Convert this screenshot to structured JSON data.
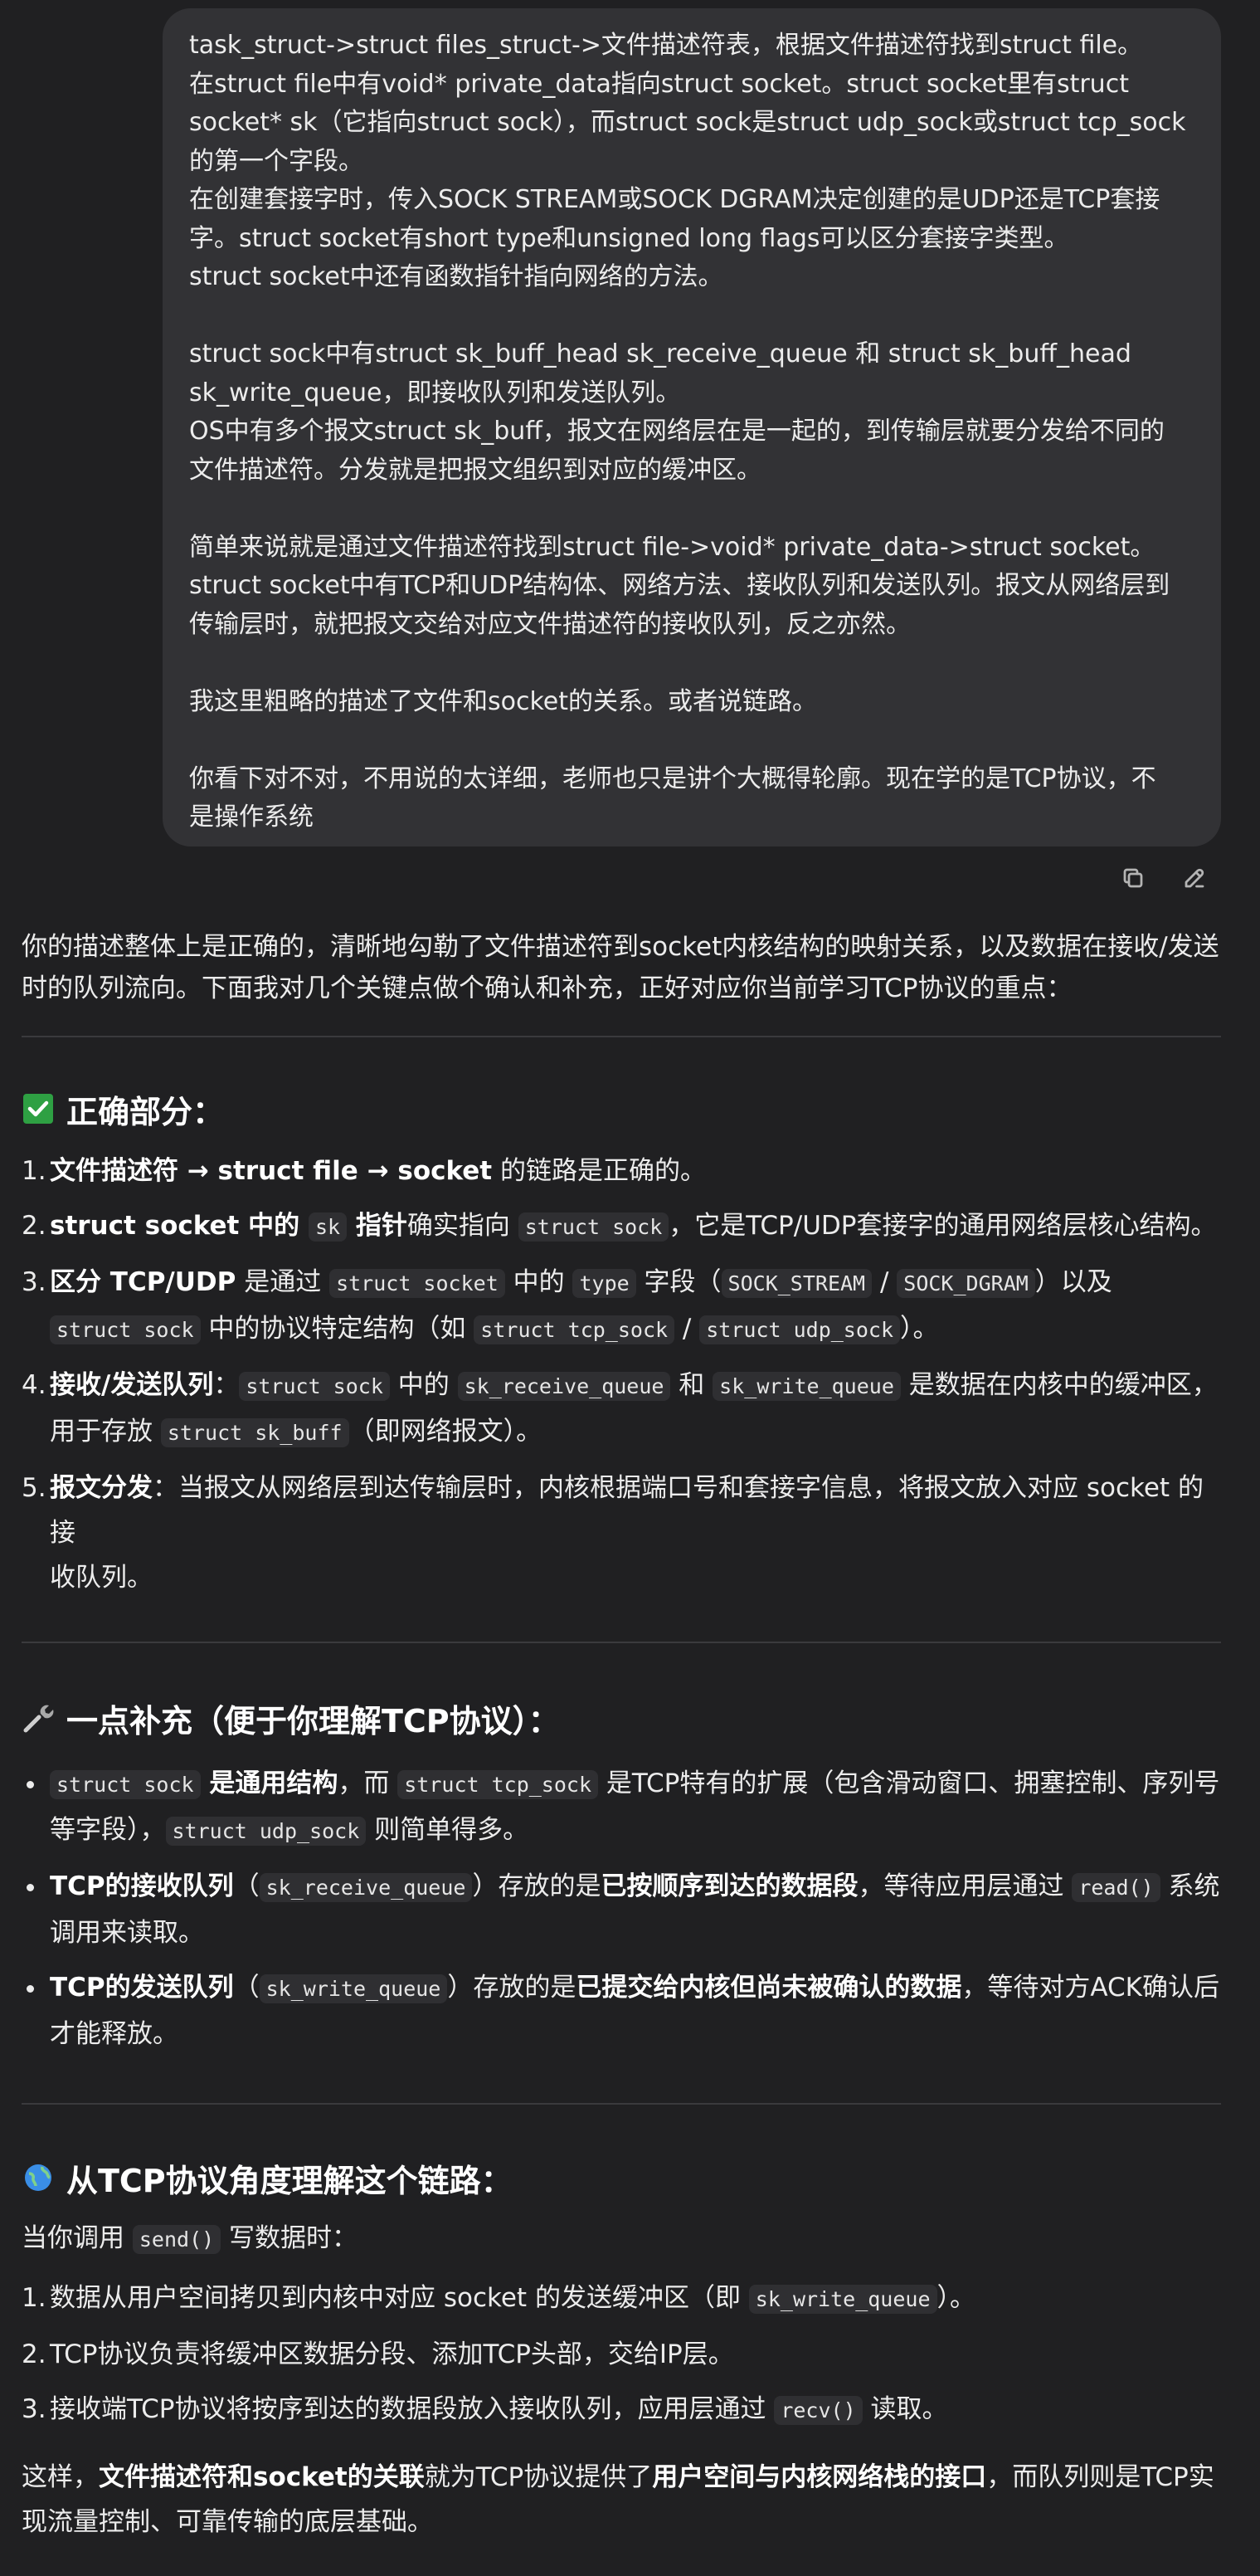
{
  "user_message": {
    "lines": [
      "task_struct->struct files_struct->文件描述符表，根据文件描述符找到struct file。",
      "在struct file中有void* private_data指向struct socket。struct socket里有struct",
      "socket* sk（它指向struct sock），而struct sock是struct udp_sock或struct tcp_sock",
      "的第一个字段。",
      "在创建套接字时，传入SOCK STREAM或SOCK DGRAM决定创建的是UDP还是TCP套接",
      "字。struct socket有short type和unsigned long flags可以区分套接字类型。",
      "struct socket中还有函数指针指向网络的方法。",
      "",
      "struct sock中有struct sk_buff_head sk_receive_queue 和 struct sk_buff_head",
      "sk_write_queue，即接收队列和发送队列。",
      "OS中有多个报文struct sk_buff，报文在网络层在是一起的，到传输层就要分发给不同的",
      "文件描述符。分发就是把报文组织到对应的缓冲区。",
      "",
      "简单来说就是通过文件描述符找到struct file->void* private_data->struct socket。",
      "struct socket中有TCP和UDP结构体、网络方法、接收队列和发送队列。报文从网络层到",
      "传输层时，就把报文交给对应文件描述符的接收队列，反之亦然。",
      "",
      "我这里粗略的描述了文件和socket的关系。或者说链路。",
      "",
      "你看下对不对，不用说的太详细，老师也只是讲个大概得轮廓。现在学的是TCP协议，不",
      "是操作系统"
    ]
  },
  "actions": {
    "copy_icon": "copy-icon",
    "edit_icon": "edit-icon"
  },
  "assistant": {
    "intro": [
      "你的描述整体上是正确的，清晰地勾勒了文件描述符到socket内核结构的映射关系，以及数据在接收/发送",
      "时的队列流向。下面我对几个关键点做个确认和补充，正好对应你当前学习TCP协议的重点："
    ],
    "section1": {
      "icon": "✅",
      "title": "正确部分：",
      "items": [
        {
          "num": "1.",
          "b1": "文件描述符 → struct file → socket",
          "t1": " 的链路是正确的。"
        },
        {
          "num": "2.",
          "b1": "struct socket 中的 ",
          "c1": "sk",
          "b2": " 指针",
          "t1": "确实指向 ",
          "c2": "struct sock",
          "t2": "，它是TCP/UDP套接字的通用网络层核心结构。"
        },
        {
          "num": "3.",
          "b1": "区分 TCP/UDP",
          "t1": " 是通过 ",
          "c1": "struct socket",
          "t2": " 中的 ",
          "c2": "type",
          "t3": " 字段（",
          "c3": "SOCK_STREAM",
          "t4": " / ",
          "c4": "SOCK_DGRAM",
          "t5": "）以及",
          "c5": "struct sock",
          "t6": " 中的协议特定结构（如 ",
          "c6": "struct tcp_sock",
          "t7": " / ",
          "c7": "struct udp_sock",
          "t8": "）。"
        },
        {
          "num": "4.",
          "b1": "接收/发送队列",
          "t1": "：",
          "c1": "struct sock",
          "t2": " 中的 ",
          "c2": "sk_receive_queue",
          "t3": " 和 ",
          "c3": "sk_write_queue",
          "t4": " 是数据在内核中的缓冲区，",
          "t5": "用于存放 ",
          "c4": "struct sk_buff",
          "t6": "（即网络报文）。"
        },
        {
          "num": "5.",
          "b1": "报文分发",
          "t1": "：当报文从网络层到达传输层时，内核根据端口号和套接字信息，将报文放入对应 socket 的接",
          "t2": "收队列。"
        }
      ]
    },
    "section2": {
      "icon": "🔧",
      "title": "一点补充（便于你理解TCP协议）：",
      "items": [
        {
          "c1": "struct sock",
          "b1": " 是通用结构",
          "t1": "，而 ",
          "c2": "struct tcp_sock",
          "t2": " 是TCP特有的扩展（包含滑动窗口、拥塞控制、序列号",
          "t3": "等字段），",
          "c3": "struct udp_sock",
          "t4": " 则简单得多。"
        },
        {
          "b1": "TCP的接收队列",
          "t1": "（",
          "c1": "sk_receive_queue",
          "t2": "）存放的是",
          "b2": "已按顺序到达的数据段",
          "t3": "，等待应用层通过 ",
          "c2": "read()",
          "t4": " 系统",
          "t5": "调用来读取。"
        },
        {
          "b1": "TCP的发送队列",
          "t1": "（",
          "c1": "sk_write_queue",
          "t2": "）存放的是",
          "b2": "已提交给内核但尚未被确认的数据",
          "t3": "，等待对方ACK确认后",
          "t4": "才能释放。"
        }
      ]
    },
    "section3": {
      "icon": "🌐",
      "title": "从TCP协议角度理解这个链路：",
      "lead_t1": "当你调用 ",
      "lead_c1": "send()",
      "lead_t2": " 写数据时：",
      "items": [
        {
          "num": "1.",
          "t1": "数据从用户空间拷贝到内核中对应 socket 的发送缓冲区（即 ",
          "c1": "sk_write_queue",
          "t2": "）。"
        },
        {
          "num": "2.",
          "t1": "TCP协议负责将缓冲区数据分段、添加TCP头部，交给IP层。"
        },
        {
          "num": "3.",
          "t1": "接收端TCP协议将按序到达的数据段放入接收队列，应用层通过 ",
          "c1": "recv()",
          "t2": " 读取。"
        }
      ],
      "closing": {
        "t1": "这样，",
        "b1": "文件描述符和socket的关联",
        "t2": "就为TCP协议提供了",
        "b2": "用户空间与内核网络栈的接口",
        "t3": "，而队列则是TCP实",
        "t4": "现流量控制、可靠传输的底层基础。"
      }
    }
  }
}
